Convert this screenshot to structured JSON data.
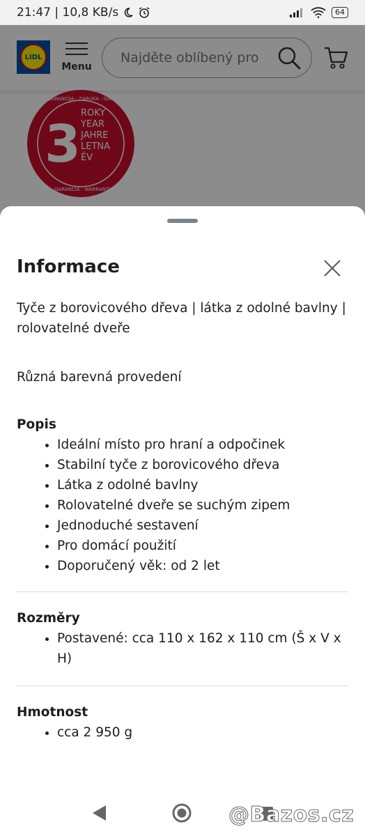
{
  "status_bar": {
    "time_speed": "21:47 | 10,8 KB/s",
    "battery": "64"
  },
  "header": {
    "logo_text": "LIDL",
    "menu_label": "Menu",
    "search_placeholder": "Najděte oblíbený pro..."
  },
  "warranty_badge": {
    "number": "3",
    "lines": [
      "ROKY",
      "YEAR",
      "JAHRE",
      "LETNA",
      "ÉV"
    ],
    "ring_top": "GARANCIJA · ZÁRUKA · GARANTIE",
    "ring_bottom": "GARANCIA · WARRANTY"
  },
  "sheet": {
    "title": "Informace",
    "intro": "Tyče z borovicového dřeva | látka z odolné bavlny | rolovatelné dveře",
    "variants": "Různá barevná provedení",
    "sections": {
      "popis": {
        "title": "Popis",
        "items": [
          "Ideální místo pro hraní a odpočinek",
          "Stabilní tyče z borovicového dřeva",
          "Látka z odolné bavlny",
          "Rolovatelné dveře se suchým zipem",
          "Jednoduché sestavení",
          "Pro domácí použití",
          "Doporučený věk: od 2 let"
        ]
      },
      "rozmery": {
        "title": "Rozměry",
        "items": [
          "Postavené: cca 110 x 162 x 110 cm (Š x V x H)"
        ]
      },
      "hmotnost": {
        "title": "Hmotnost",
        "items": [
          "cca 2 950 g"
        ]
      }
    }
  },
  "watermark": "@Bazos.cz",
  "colors": {
    "lidl_blue": "#0050aa",
    "lidl_yellow": "#fff000",
    "lidl_red": "#e60a14",
    "badge_red": "#c8102e"
  }
}
